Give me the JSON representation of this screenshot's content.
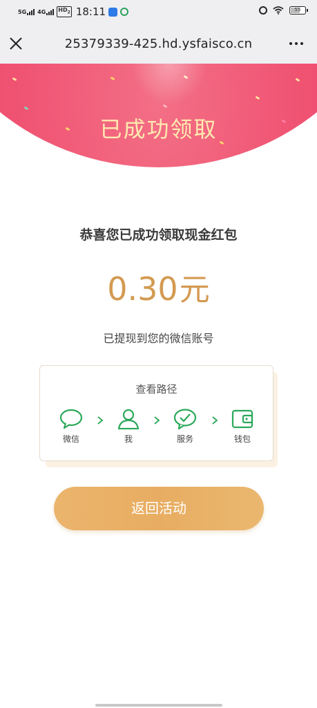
{
  "status_bar": {
    "net1": "5G",
    "net2": "4G",
    "hd": "HD",
    "hd_sub": "2",
    "time": "18:11",
    "battery": "55"
  },
  "browser": {
    "url": "25379339-425.hd.ysfaisco.cn",
    "close_icon": "close-icon",
    "more_icon": "more-icon"
  },
  "banner": {
    "title": "已成功领取"
  },
  "main": {
    "congrats": "恭喜您已成功领取现金红包",
    "amount": "0.30",
    "amount_unit": "元",
    "note": "已提现到您的微信账号"
  },
  "path_card": {
    "title": "查看路径",
    "steps": [
      {
        "label": "微信",
        "icon": "chat-bubble-icon"
      },
      {
        "label": "我",
        "icon": "user-icon"
      },
      {
        "label": "服务",
        "icon": "check-circle-icon"
      },
      {
        "label": "钱包",
        "icon": "wallet-icon"
      }
    ]
  },
  "actions": {
    "back_label": "返回活动"
  },
  "colors": {
    "banner": "#ec4166",
    "banner_title": "#ffe9b0",
    "amount": "#d39a52",
    "icon_green": "#2aa859",
    "button": "#e8ad62"
  }
}
